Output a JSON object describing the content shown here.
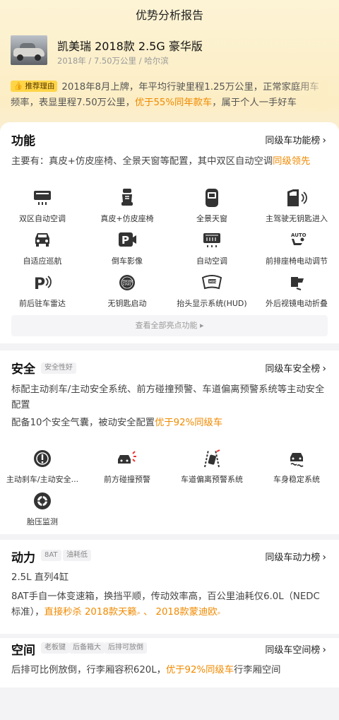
{
  "header": {
    "title": "优势分析报告"
  },
  "car": {
    "name": "凯美瑞 2018款 2.5G 豪华版",
    "meta": "2018年 / 7.50万公里 / 哈尔滨"
  },
  "reason": {
    "tag": "推荐理由",
    "text_before": "2018年8月上牌，年平均行驶里程1.25万公里，正常家庭用车频率，表显里程7.50万公里，",
    "highlight": "优于55%同年款车",
    "text_after": "，属于个人一手好车"
  },
  "features": {
    "title": "功能",
    "link": "同级车功能榜",
    "summary_before": "主要有：真皮+仿皮座椅、全景天窗等配置，其中双区自动空调",
    "summary_highlight": "级领先",
    "summary_highlight_pre": "同",
    "items": [
      {
        "label": "双区自动空调",
        "icon": "ac-panel-icon"
      },
      {
        "label": "真皮+仿皮座椅",
        "icon": "seat-icon"
      },
      {
        "label": "全景天窗",
        "icon": "sunroof-icon"
      },
      {
        "label": "主驾驶无钥匙进入",
        "icon": "keyless-door-icon"
      },
      {
        "label": "自适应巡航",
        "icon": "adaptive-cruise-icon"
      },
      {
        "label": "倒车影像",
        "icon": "reverse-camera-icon"
      },
      {
        "label": "自动空调",
        "icon": "auto-ac-icon"
      },
      {
        "label": "前排座椅电动调节",
        "icon": "power-seat-icon"
      },
      {
        "label": "前后驻车雷达",
        "icon": "parking-radar-icon"
      },
      {
        "label": "无钥匙启动",
        "icon": "start-stop-button-icon"
      },
      {
        "label": "抬头显示系统(HUD)",
        "icon": "hud-icon"
      },
      {
        "label": "外后视镜电动折叠",
        "icon": "mirror-fold-icon"
      }
    ],
    "more": "查看全部亮点功能"
  },
  "safety": {
    "title": "安全",
    "tag": "安全性好",
    "link": "同级车安全榜",
    "line1": "标配主动刹车/主动安全系统、前方碰撞预警、车道偏离预警系统等主动安全配置",
    "line2_before": "配备10个安全气囊，被动安全配置",
    "line2_highlight": "优于92%同级车",
    "items": [
      {
        "label": "主动刹车/主动安全...",
        "icon": "brake-warning-icon"
      },
      {
        "label": "前方碰撞预警",
        "icon": "collision-warning-icon"
      },
      {
        "label": "车道偏离预警系统",
        "icon": "lane-departure-icon"
      },
      {
        "label": "车身稳定系统",
        "icon": "stability-control-icon"
      },
      {
        "label": "胎压监测",
        "icon": "tire-pressure-icon"
      }
    ]
  },
  "power": {
    "title": "动力",
    "tags": [
      "8AT",
      "油耗低"
    ],
    "link": "同级车动力榜",
    "engine": "2.5L 直列4缸",
    "desc_before": "8AT手自一体变速箱，换挡平顺，传动效率高，百公里油耗仅6.0L（NEDC标准），",
    "desc_highlight1": "直接秒杀 2018款天籁",
    "desc_sep": " 、 ",
    "desc_highlight2": "2018款蒙迪欧"
  },
  "space": {
    "title": "空间",
    "tags": [
      "老板键",
      "后备箱大",
      "后排可放倒"
    ],
    "link": "同级车空间榜",
    "desc_before": "后排可比例放倒，行李厢容积620L，",
    "desc_highlight": "优于92%同级车",
    "desc_after": "行李厢空间"
  },
  "colors": {
    "highlight": "#f08a00",
    "tag_bg": "#ffd548"
  }
}
